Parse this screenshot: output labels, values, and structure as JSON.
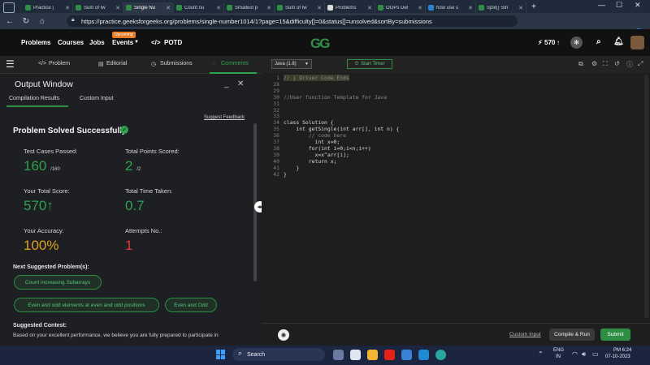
{
  "browser": {
    "tabs": [
      {
        "title": "Practice |"
      },
      {
        "title": "Sum of tw"
      },
      {
        "title": "Single Nu"
      },
      {
        "title": "Count nu"
      },
      {
        "title": "Smallest p"
      },
      {
        "title": "Sum of tw"
      },
      {
        "title": "Problems"
      },
      {
        "title": "OOPs Def"
      },
      {
        "title": "how use s"
      },
      {
        "title": "Split() Stri"
      }
    ],
    "url": "https://practice.geeksforgeeks.org/problems/single-number1014/1?page=15&difficulty[]=0&status[]=unsolved&sortBy=submissions"
  },
  "gfg_header": {
    "problems": "Problems",
    "courses": "Courses",
    "jobs": "Jobs",
    "events": "Events",
    "trending_badge": "Upcoming",
    "potd": "POTD",
    "logo": "GG",
    "score": "570"
  },
  "problem_tabs": {
    "problem": "Problem",
    "editorial": "Editorial",
    "submissions": "Submissions",
    "comments": "Comments"
  },
  "output": {
    "title": "Output Window",
    "tab_compile": "Compilation Results",
    "tab_custom": "Custom Input",
    "suggest_feedback": "Suggest Feedback",
    "status": "Problem Solved Successfully",
    "stats": {
      "test_cases_label": "Test Cases Passed:",
      "test_cases_value": "160",
      "test_cases_total": "/160",
      "points_label": "Total Points Scored:",
      "points_value": "2",
      "points_total": "/2",
      "score_label": "Your Total Score:",
      "score_value": "570",
      "time_label": "Total Time Taken:",
      "time_value": "0.7",
      "accuracy_label": "Your Accuracy:",
      "accuracy_value": "100%",
      "attempts_label": "Attempts No.:",
      "attempts_value": "1"
    },
    "next_suggested_label": "Next Suggested Problem(s):",
    "suggestions": [
      "Count increasing Subarrays",
      "Even and odd elements at even and odd positions",
      "Even and Odd"
    ],
    "contest_label": "Suggested Contest:",
    "contest_text": "Based on your excellent performance, we believe you are fully prepared to participate in"
  },
  "editor": {
    "language": "Java (1.8)",
    "start_timer": "Start Timer",
    "lines": [
      {
        "n": "1",
        "text": "// } Driver Code Ends"
      },
      {
        "n": "28",
        "text": ""
      },
      {
        "n": "29",
        "text": ""
      },
      {
        "n": "30",
        "text": "//User function Template for Java"
      },
      {
        "n": "31",
        "text": ""
      },
      {
        "n": "32",
        "text": ""
      },
      {
        "n": "33",
        "text": ""
      },
      {
        "n": "34",
        "text": "class Solution {"
      },
      {
        "n": "35",
        "text": "    int getSingle(int arr[], int n) {"
      },
      {
        "n": "36",
        "text": "        // code here"
      },
      {
        "n": "37",
        "text": "          int x=0;"
      },
      {
        "n": "38",
        "text": "        for(int i=0;i<n;i++)"
      },
      {
        "n": "39",
        "text": "          x=x^arr[i];"
      },
      {
        "n": "40",
        "text": "        return x;"
      },
      {
        "n": "41",
        "text": "    }"
      },
      {
        "n": "42",
        "text": "}"
      }
    ],
    "custom_input": "Custom Input",
    "compile_run": "Compile & Run",
    "submit": "Submit"
  },
  "taskbar": {
    "search": "Search",
    "lang": "ENG",
    "region": "IN",
    "time": "PM 6:24",
    "date": "07-10-2023"
  },
  "colors": {
    "accent": "#2f8d46",
    "success": "#2fa24f",
    "accuracy": "#e0a11b",
    "attempts": "#e53935"
  }
}
